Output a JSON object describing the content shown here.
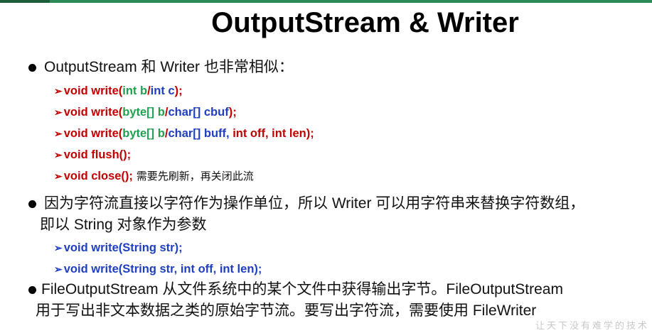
{
  "title": "OutputStream & Writer",
  "bullet1": {
    "text": "OutputStream 和 Writer 也非常相似："
  },
  "methods1": [
    {
      "p1": "void write(",
      "p2": "int b",
      "p3": "/",
      "p4": "int c",
      "p5": ");"
    },
    {
      "p1": "void write(",
      "p2": "byte[] b",
      "p3": "/",
      "p4": "char[] cbuf",
      "p5": ");"
    },
    {
      "p1": "void write(",
      "p2": "byte[] b",
      "p3": "/",
      "p4": "char[] buff,",
      "p5": " int off, int len);"
    },
    {
      "p1": "void flush();"
    },
    {
      "p1": "void close();",
      "note": " 需要先刷新，再关闭此流"
    }
  ],
  "bullet2": {
    "line1": "因为字符流直接以字符作为操作单位，所以 Writer 可以用字符串来替换字符数组，",
    "line2": "即以 String 对象作为参数"
  },
  "methods2": [
    {
      "p1": "void write(String str);"
    },
    {
      "p1": "void write(String str, int off, int len);"
    }
  ],
  "bullet3": {
    "line1": " FileOutputStream 从文件系统中的某个文件中获得输出字节。FileOutputStream",
    "line2": "用于写出非文本数据之类的原始字节流。要写出字符流，需要使用 FileWriter"
  },
  "watermark": "让天下没有难学的技术"
}
